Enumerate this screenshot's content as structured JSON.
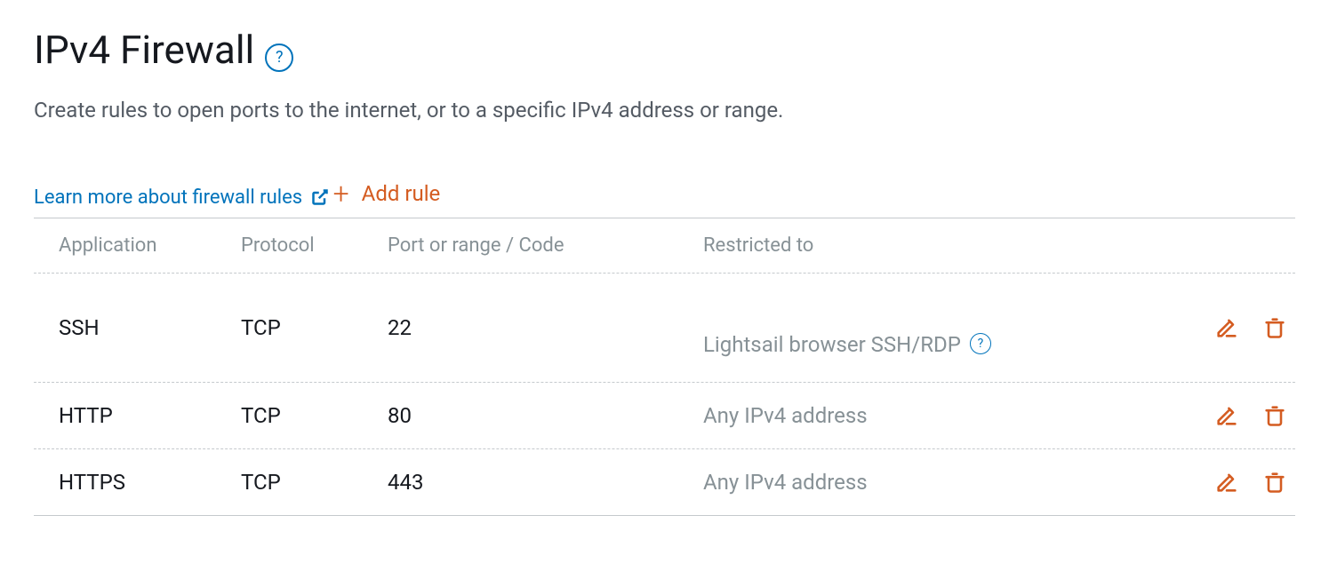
{
  "title": "IPv4 Firewall",
  "subtext": "Create rules to open ports to the internet, or to a specific IPv4 address or range.",
  "learn_more": "Learn more about firewall rules",
  "add_rule": "Add rule",
  "columns": {
    "application": "Application",
    "protocol": "Protocol",
    "port": "Port or range / Code",
    "restricted": "Restricted to"
  },
  "rules": [
    {
      "application": "SSH",
      "protocol": "TCP",
      "port": "22",
      "restricted": "Lightsail browser SSH/RDP",
      "help": true
    },
    {
      "application": "HTTP",
      "protocol": "TCP",
      "port": "80",
      "restricted": "Any IPv4 address"
    },
    {
      "application": "HTTPS",
      "protocol": "TCP",
      "port": "443",
      "restricted": "Any IPv4 address"
    }
  ]
}
